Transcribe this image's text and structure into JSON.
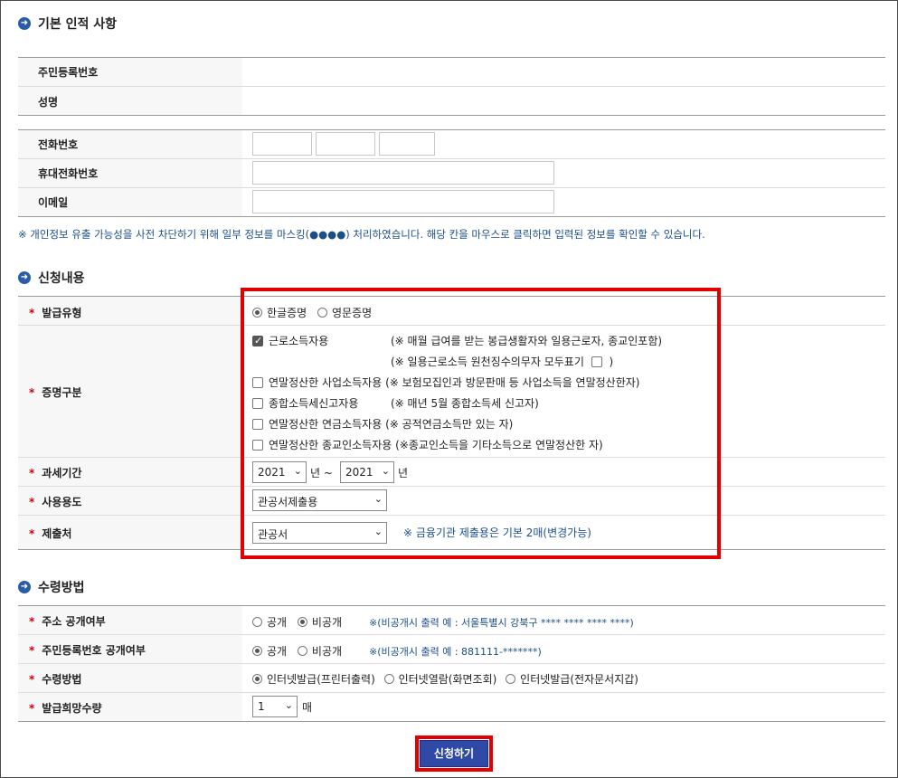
{
  "personal": {
    "title": "기본 인적 사항",
    "rows": [
      {
        "label": "주민등록번호"
      },
      {
        "label": "성명"
      }
    ],
    "contact_rows": [
      {
        "label": "전화번호"
      },
      {
        "label": "휴대전화번호"
      },
      {
        "label": "이메일"
      }
    ],
    "notice": "※ 개인정보 유출 가능성을 사전 차단하기 위해 일부 정보를 마스킹(●●●●) 처리하였습니다. 해당 칸을 마우스로 클릭하면 입력된 정보를 확인할 수 있습니다."
  },
  "request": {
    "title": "신청내용",
    "required_mark": "*",
    "issue_type": {
      "label": "발급유형",
      "options": [
        "한글증명",
        "영문증명"
      ],
      "selected": "한글증명"
    },
    "cert_type": {
      "label": "증명구분",
      "items": [
        {
          "label": "근로소득자용",
          "note": "(※ 매월 급여를 받는 봉급생활자와 일용근로자, 종교인포함)",
          "checked": true
        },
        {
          "label": "연말정산한 사업소득자용",
          "note": "(※ 보험모집인과 방문판매 등 사업소득을 연말정산한자)",
          "checked": false
        },
        {
          "label": "종합소득세신고자용",
          "note": "(※ 매년 5월 종합소득세 신고자)",
          "checked": false
        },
        {
          "label": "연말정산한 연금소득자용",
          "note": "(※ 공적연금소득만 있는 자)",
          "checked": false
        },
        {
          "label": "연말정산한 종교인소득자용",
          "note": "(※종교인소득을 기타소득으로 연말정산한 자)",
          "checked": false
        }
      ],
      "sub_note_prefix": "(※ 일용근로소득 원천징수의무자 모두표기",
      "sub_note_suffix": ")"
    },
    "tax_period": {
      "label": "과세기간",
      "from_year": "2021",
      "from_unit": "년 ~",
      "to_year": "2021",
      "to_unit": "년"
    },
    "usage": {
      "label": "사용용도",
      "value": "관공서제출용"
    },
    "submit_to": {
      "label": "제출처",
      "value": "관공서",
      "note": "※ 금융기관 제출용은 기본 2매(변경가능)"
    }
  },
  "receive": {
    "title": "수령방법",
    "address_public": {
      "label": "주소 공개여부",
      "options": [
        "공개",
        "비공개"
      ],
      "selected": "비공개",
      "note": "※(비공개시 출력 예 : 서울특별시 강북구 **** **** **** ****)"
    },
    "rrn_public": {
      "label": "주민등록번호 공개여부",
      "options": [
        "공개",
        "비공개"
      ],
      "selected": "공개",
      "note": "※(비공개시 출력 예 : 881111-*******)"
    },
    "method": {
      "label": "수령방법",
      "options": [
        "인터넷발급(프린터출력)",
        "인터넷열람(화면조회)",
        "인터넷발급(전자문서지갑)"
      ],
      "selected": "인터넷발급(프린터출력)"
    },
    "copies": {
      "label": "발급희망수량",
      "value": "1",
      "unit": "매"
    }
  },
  "submit_button": "신청하기",
  "icons": {
    "section_bullet": "arrow-circle-icon",
    "select_arrow": "chevron-down-icon"
  },
  "colors": {
    "highlight": "#e30000",
    "button": "#2e4aa6",
    "note": "#1b4f8a",
    "required": "#d40000"
  }
}
